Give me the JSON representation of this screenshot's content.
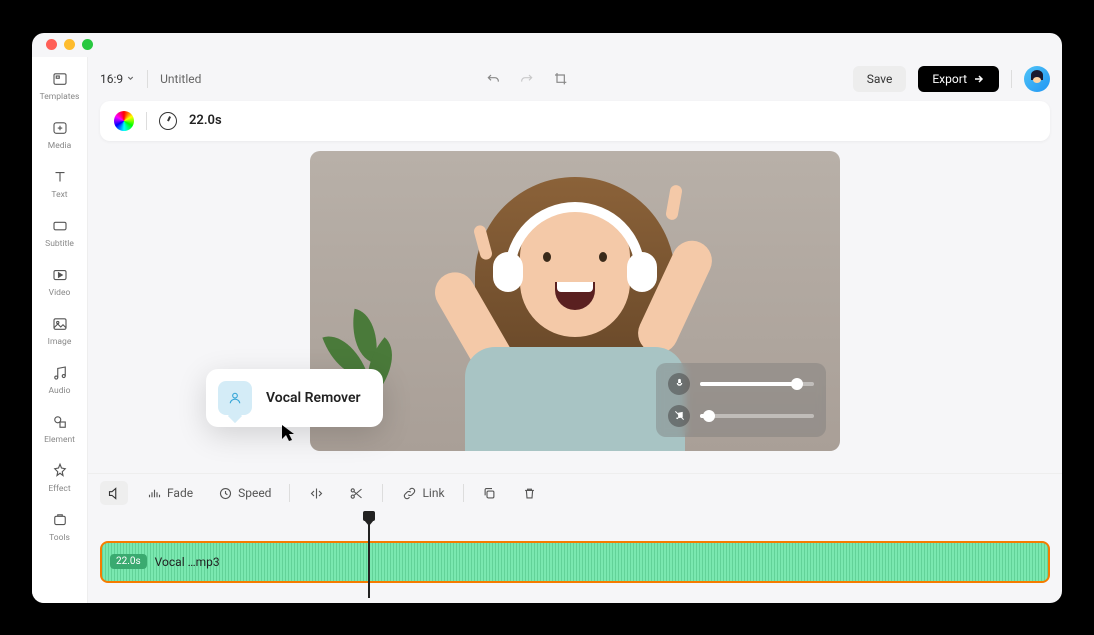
{
  "sidebar": {
    "items": [
      {
        "label": "Templates",
        "icon": "templates"
      },
      {
        "label": "Media",
        "icon": "media"
      },
      {
        "label": "Text",
        "icon": "text"
      },
      {
        "label": "Subtitle",
        "icon": "subtitle"
      },
      {
        "label": "Video",
        "icon": "video"
      },
      {
        "label": "Image",
        "icon": "image"
      },
      {
        "label": "Audio",
        "icon": "audio"
      },
      {
        "label": "Element",
        "icon": "element"
      },
      {
        "label": "Effect",
        "icon": "effect"
      },
      {
        "label": "Tools",
        "icon": "tools"
      }
    ]
  },
  "topbar": {
    "ratio": "16:9",
    "title": "Untitled",
    "save_label": "Save",
    "export_label": "Export"
  },
  "infobar": {
    "duration": "22.0s"
  },
  "tooltip": {
    "label": "Vocal Remover"
  },
  "volume": {
    "mic_level": 85,
    "music_level": 8
  },
  "toolbar": {
    "items": [
      {
        "label": "",
        "icon": "volume",
        "active": true
      },
      {
        "label": "Fade",
        "icon": "fade"
      },
      {
        "label": "Speed",
        "icon": "speed"
      },
      {
        "label": "",
        "icon": "flip"
      },
      {
        "label": "",
        "icon": "cut"
      },
      {
        "label": "Link",
        "icon": "link"
      },
      {
        "label": "",
        "icon": "copy"
      },
      {
        "label": "",
        "icon": "trash"
      }
    ]
  },
  "timeline": {
    "clip_time": "22.0s",
    "clip_name": "Vocal …mp3"
  }
}
